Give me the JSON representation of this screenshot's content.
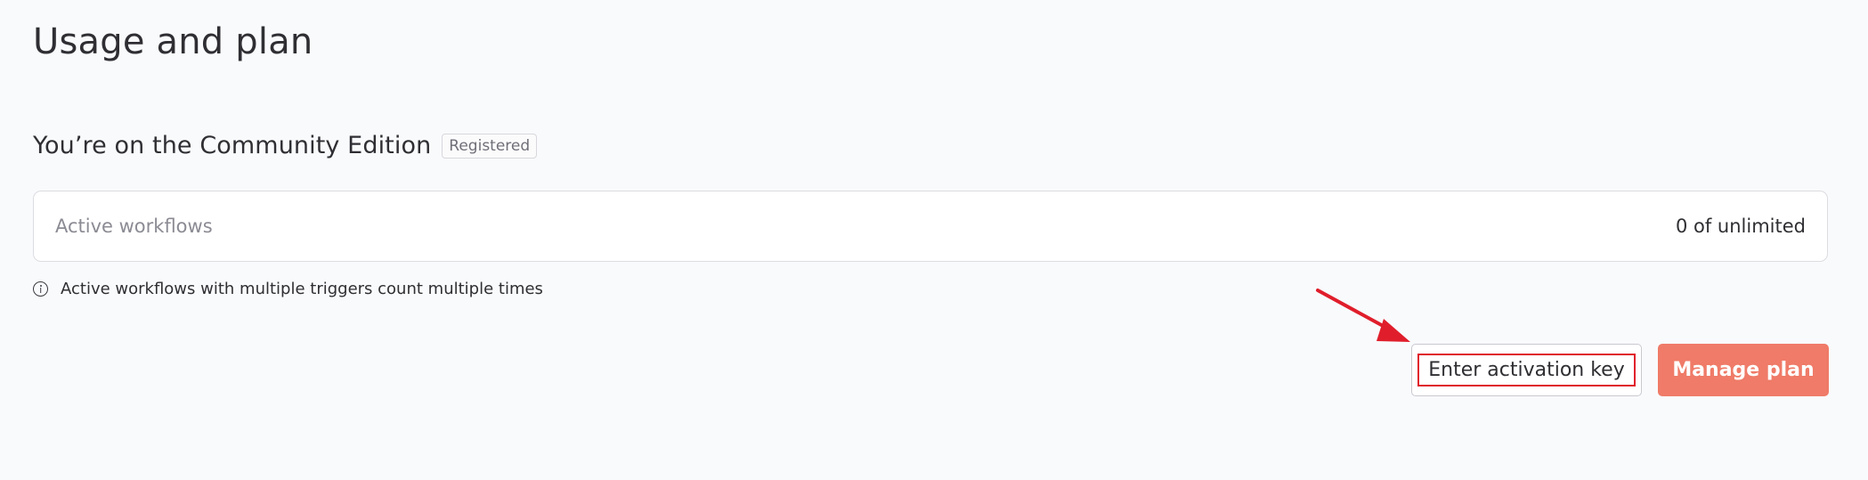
{
  "page": {
    "title": "Usage and plan"
  },
  "plan": {
    "edition_text": "You’re on the Community Edition",
    "badge": "Registered"
  },
  "usage": {
    "active_workflows_label": "Active workflows",
    "active_workflows_value": "0 of unlimited",
    "info_text": "Active workflows with multiple triggers count multiple times",
    "info_icon": "info-circle-icon"
  },
  "actions": {
    "activation_label": "Enter activation key",
    "manage_label": "Manage plan"
  },
  "colors": {
    "accent": "#ef7b68",
    "annotation": "#e01e2b"
  }
}
